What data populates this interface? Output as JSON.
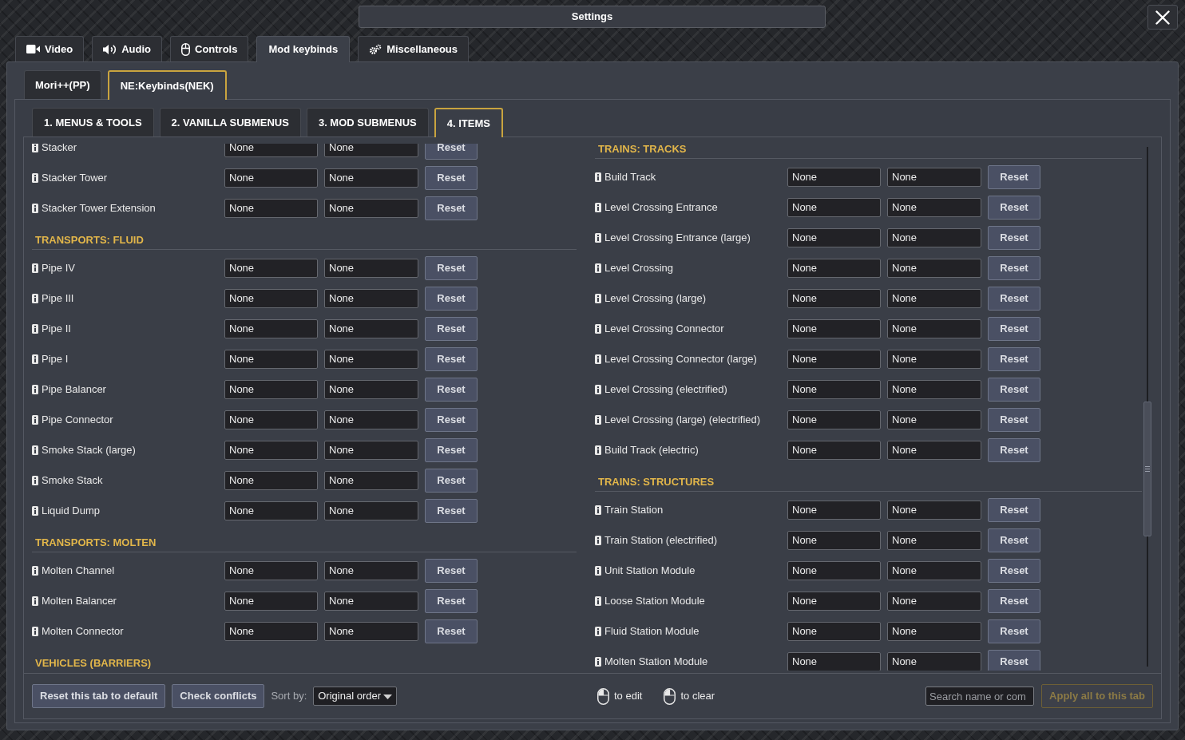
{
  "window": {
    "title": "Settings"
  },
  "main_tabs": [
    {
      "label": "Video",
      "selected": false
    },
    {
      "label": "Audio",
      "selected": false
    },
    {
      "label": "Controls",
      "selected": false
    },
    {
      "label": "Mod keybinds",
      "selected": true
    },
    {
      "label": "Miscellaneous",
      "selected": false
    }
  ],
  "mod_tabs": [
    {
      "label": "Mori++(PP)",
      "selected": false
    },
    {
      "label": "NE:Keybinds(NEK)",
      "selected": true
    }
  ],
  "category_tabs": [
    {
      "label": "1. MENUS & TOOLS",
      "selected": false
    },
    {
      "label": "2. VANILLA SUBMENUS",
      "selected": false
    },
    {
      "label": "3. MOD SUBMENUS",
      "selected": false
    },
    {
      "label": "4. ITEMS",
      "selected": true
    }
  ],
  "columns": [
    {
      "sections": [
        {
          "rows": [
            {
              "name": "Stacker",
              "key_1": "None",
              "key_2": "None",
              "reset": "Reset"
            },
            {
              "name": "Stacker Tower",
              "key_1": "None",
              "key_2": "None",
              "reset": "Reset"
            },
            {
              "name": "Stacker Tower Extension",
              "key_1": "None",
              "key_2": "None",
              "reset": "Reset"
            }
          ]
        },
        {
          "header": "TRANSPORTS: FLUID",
          "rows": [
            {
              "name": "Pipe IV",
              "key_1": "None",
              "key_2": "None",
              "reset": "Reset"
            },
            {
              "name": "Pipe III",
              "key_1": "None",
              "key_2": "None",
              "reset": "Reset"
            },
            {
              "name": "Pipe II",
              "key_1": "None",
              "key_2": "None",
              "reset": "Reset"
            },
            {
              "name": "Pipe I",
              "key_1": "None",
              "key_2": "None",
              "reset": "Reset"
            },
            {
              "name": "Pipe Balancer",
              "key_1": "None",
              "key_2": "None",
              "reset": "Reset"
            },
            {
              "name": "Pipe Connector",
              "key_1": "None",
              "key_2": "None",
              "reset": "Reset"
            },
            {
              "name": "Smoke Stack (large)",
              "key_1": "None",
              "key_2": "None",
              "reset": "Reset"
            },
            {
              "name": "Smoke Stack",
              "key_1": "None",
              "key_2": "None",
              "reset": "Reset"
            },
            {
              "name": "Liquid Dump",
              "key_1": "None",
              "key_2": "None",
              "reset": "Reset"
            }
          ]
        },
        {
          "header": "TRANSPORTS: MOLTEN",
          "rows": [
            {
              "name": "Molten Channel",
              "key_1": "None",
              "key_2": "None",
              "reset": "Reset"
            },
            {
              "name": "Molten Balancer",
              "key_1": "None",
              "key_2": "None",
              "reset": "Reset"
            },
            {
              "name": "Molten Connector",
              "key_1": "None",
              "key_2": "None",
              "reset": "Reset"
            }
          ]
        },
        {
          "header": "VEHICLES (BARRIERS)"
        }
      ]
    },
    {
      "sections": [
        {
          "header": "TRAINS: TRACKS",
          "rows": [
            {
              "name": "Build Track",
              "key_1": "None",
              "key_2": "None",
              "reset": "Reset"
            },
            {
              "name": "Level Crossing Entrance",
              "key_1": "None",
              "key_2": "None",
              "reset": "Reset"
            },
            {
              "name": "Level Crossing Entrance (large)",
              "key_1": "None",
              "key_2": "None",
              "reset": "Reset"
            },
            {
              "name": "Level Crossing",
              "key_1": "None",
              "key_2": "None",
              "reset": "Reset"
            },
            {
              "name": "Level Crossing (large)",
              "key_1": "None",
              "key_2": "None",
              "reset": "Reset"
            },
            {
              "name": "Level Crossing Connector",
              "key_1": "None",
              "key_2": "None",
              "reset": "Reset"
            },
            {
              "name": "Level Crossing Connector (large)",
              "key_1": "None",
              "key_2": "None",
              "reset": "Reset"
            },
            {
              "name": "Level Crossing (electrified)",
              "key_1": "None",
              "key_2": "None",
              "reset": "Reset"
            },
            {
              "name": "Level Crossing (large) (electrified)",
              "key_1": "None",
              "key_2": "None",
              "reset": "Reset"
            },
            {
              "name": "Build Track (electric)",
              "key_1": "None",
              "key_2": "None",
              "reset": "Reset"
            }
          ]
        },
        {
          "header": "TRAINS: STRUCTURES",
          "rows": [
            {
              "name": "Train Station",
              "key_1": "None",
              "key_2": "None",
              "reset": "Reset"
            },
            {
              "name": "Train Station (electrified)",
              "key_1": "None",
              "key_2": "None",
              "reset": "Reset"
            },
            {
              "name": "Unit Station Module",
              "key_1": "None",
              "key_2": "None",
              "reset": "Reset"
            },
            {
              "name": "Loose Station Module",
              "key_1": "None",
              "key_2": "None",
              "reset": "Reset"
            },
            {
              "name": "Fluid Station Module",
              "key_1": "None",
              "key_2": "None",
              "reset": "Reset"
            },
            {
              "name": "Molten Station Module",
              "key_1": "None",
              "key_2": "None",
              "reset": "Reset"
            }
          ]
        }
      ]
    }
  ],
  "bottom_bar": {
    "reset_tab_button": "Reset this tab to default",
    "check_conflicts_button": "Check conflicts",
    "sort": {
      "label": "Sort by:",
      "value": "Original order"
    },
    "hints": [
      {
        "kind": "left",
        "text": "to edit"
      },
      {
        "kind": "left",
        "text": "to clear"
      }
    ],
    "search": {
      "placeholder": "Search name or com"
    },
    "apply_button": {
      "label": "Apply all to this tab",
      "disabled": true
    }
  }
}
